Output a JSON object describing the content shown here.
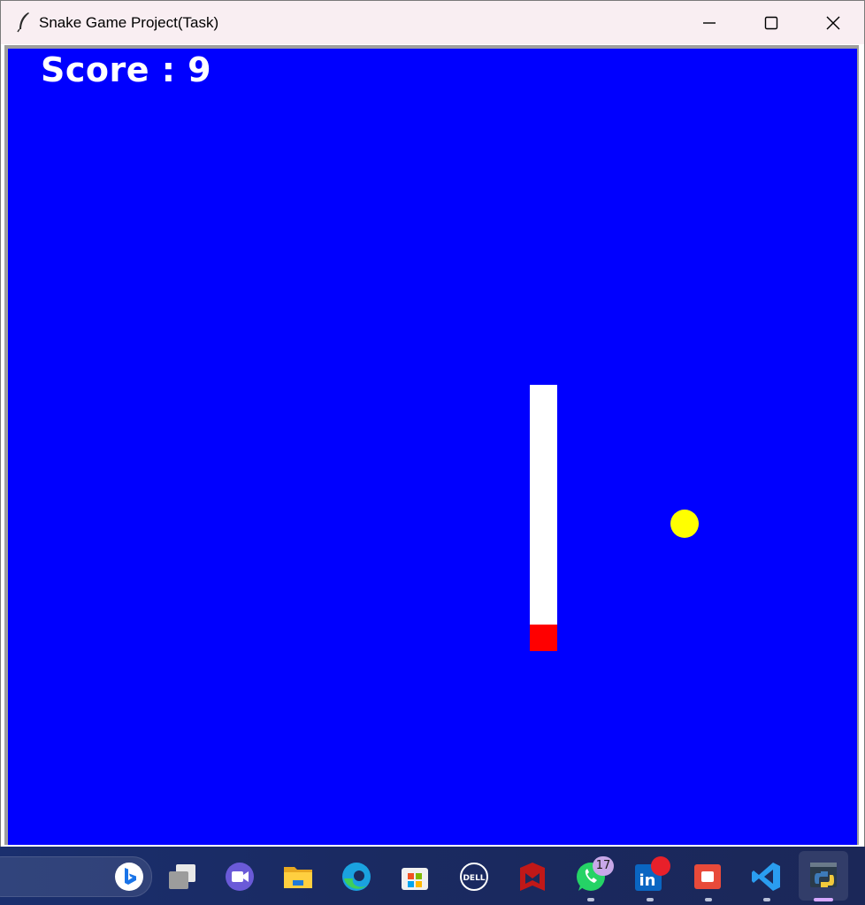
{
  "window": {
    "title": "Snake Game Project(Task)"
  },
  "game": {
    "score_text": "Score : 9",
    "colors": {
      "background": "#0000ff",
      "snake_body": "#ffffff",
      "snake_head": "#ff0000",
      "food": "#ffff00",
      "score_text": "#ffffff"
    }
  },
  "taskbar": {
    "icons": [
      "bing-icon",
      "task-view-icon",
      "meet-icon",
      "file-explorer-icon",
      "edge-icon",
      "store-icon",
      "dell-icon",
      "mcafee-icon",
      "whatsapp-icon",
      "linkedin-icon",
      "screen-recorder-icon",
      "vscode-icon",
      "python-icon"
    ],
    "whatsapp_badge": "17"
  }
}
